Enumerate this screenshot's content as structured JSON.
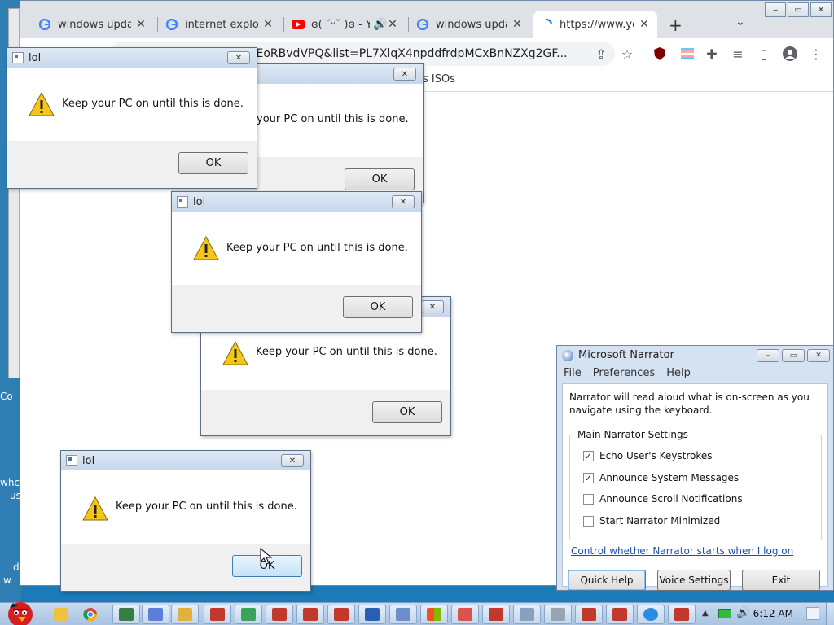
{
  "desktop": {
    "fragments": [
      "Co",
      "whc",
      "us",
      "d",
      "w"
    ]
  },
  "browser": {
    "tabs": [
      {
        "title": "windows updat",
        "icon": "google-icon"
      },
      {
        "title": "internet explore",
        "icon": "google-icon"
      },
      {
        "title": "ɞ( ˘ᵕ˘ )ɞ - Yo",
        "icon": "youtube-icon"
      },
      {
        "title": "windows updat",
        "icon": "google-icon"
      },
      {
        "title": "https://www.yo",
        "icon": "loading-spinner-icon"
      }
    ],
    "address": "=q6EoRBvdVPQ&list=PL7XlqX4npddfrdpMCxBnNZXg2GF...",
    "bookmark": "s ISOs",
    "tab_close": "✕",
    "new_tab": "+",
    "tab_menu": "⌄",
    "window_controls": [
      "‒",
      "▭",
      "✕"
    ]
  },
  "dialogs": [
    {
      "title": "lol",
      "message": "Keep your PC on until this is done.",
      "button": "OK"
    },
    {
      "title": "",
      "message": "your PC on until this is done.",
      "button": "OK"
    },
    {
      "title": "lol",
      "message": "Keep your PC on until this is done.",
      "button": "OK"
    },
    {
      "title": "",
      "message": "Keep your PC on until this is done.",
      "button": "OK"
    },
    {
      "title": "lol",
      "message": "Keep your PC on until this is done.",
      "button": "OK"
    }
  ],
  "narrator": {
    "title": "Microsoft Narrator",
    "menu": [
      "File",
      "Preferences",
      "Help"
    ],
    "description": "Narrator will read aloud what is on-screen as you navigate using the keyboard.",
    "group_label": "Main Narrator Settings",
    "options": [
      {
        "label": "Echo User's Keystrokes",
        "checked": true
      },
      {
        "label": "Announce System Messages",
        "checked": true
      },
      {
        "label": "Announce Scroll Notifications",
        "checked": false
      },
      {
        "label": "Start Narrator Minimized",
        "checked": false
      }
    ],
    "link": "Control whether Narrator starts when I log on",
    "buttons": [
      "Quick Help",
      "Voice Settings",
      "Exit"
    ]
  },
  "taskbar": {
    "clock": "6:12 AM"
  },
  "colors": {
    "chrome_tabstrip": "#dee1e6",
    "dialog_footer": "#f0f0f0",
    "warning_yellow": "#f5c518",
    "link_blue": "#1a4fb3",
    "taskbar": "#b5cbe6"
  }
}
